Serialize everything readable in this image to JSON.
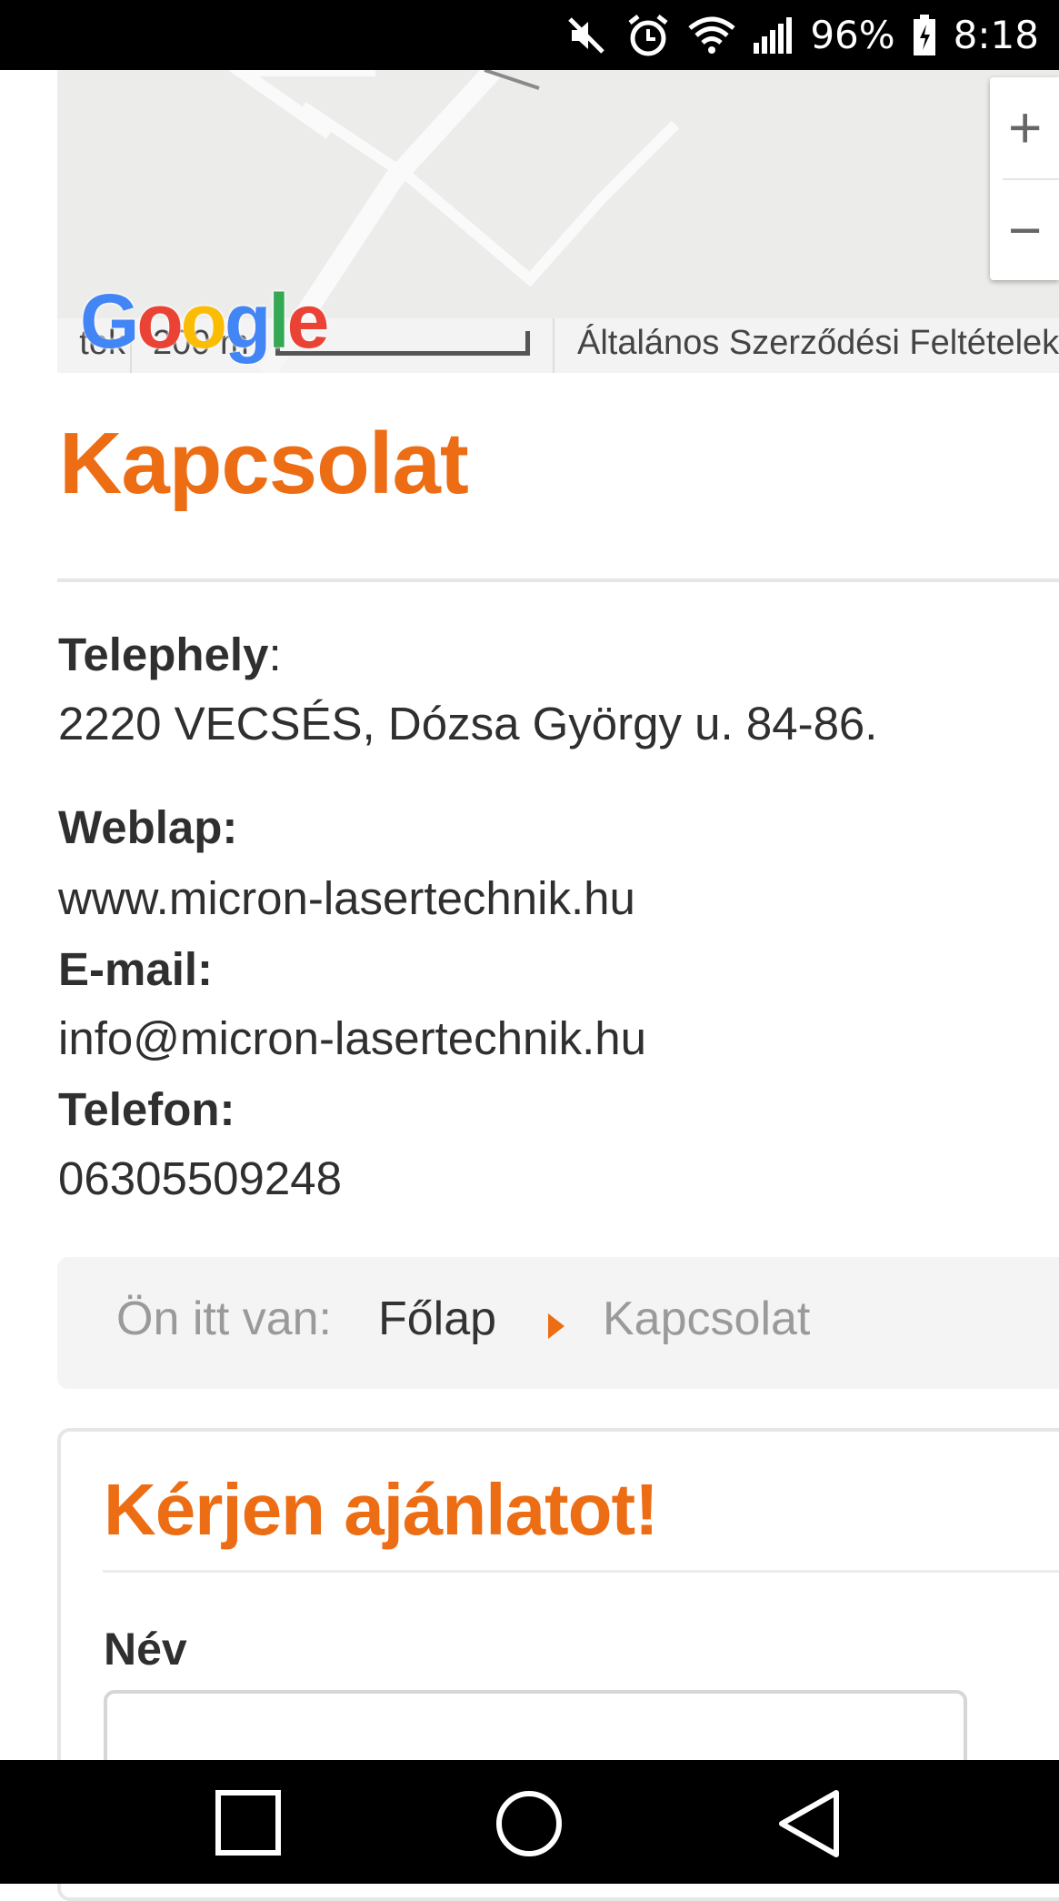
{
  "status_bar": {
    "battery": "96%",
    "time": "8:18",
    "icons": [
      "mute-icon",
      "alarm-icon",
      "wifi-icon",
      "signal-icon",
      "battery-icon"
    ]
  },
  "map": {
    "logo": "Google",
    "zoom_in": "+",
    "zoom_out": "−",
    "footer_left": "tok",
    "scale": "200 m",
    "terms": "Általános Szerződési Feltételek"
  },
  "page": {
    "title": "Kapcsolat",
    "site_label": "Telephely",
    "site_colon": ":",
    "address": "2220 VECSÉS, Dózsa György u. 84-86.",
    "web_label": "Weblap:",
    "web_value": "www.micron-lasertechnik.hu",
    "email_label": "E-mail:",
    "email_value": "info@micron-lasertechnik.hu",
    "phone_label": "Telefon:",
    "phone_value": "06305509248"
  },
  "breadcrumb": {
    "label": "Ön itt van:",
    "home": "Főlap",
    "current": "Kapcsolat"
  },
  "form": {
    "title": "Kérjen ajánlatot!",
    "name_label": "Név",
    "name_value": ""
  },
  "colors": {
    "accent": "#ec6d14"
  }
}
